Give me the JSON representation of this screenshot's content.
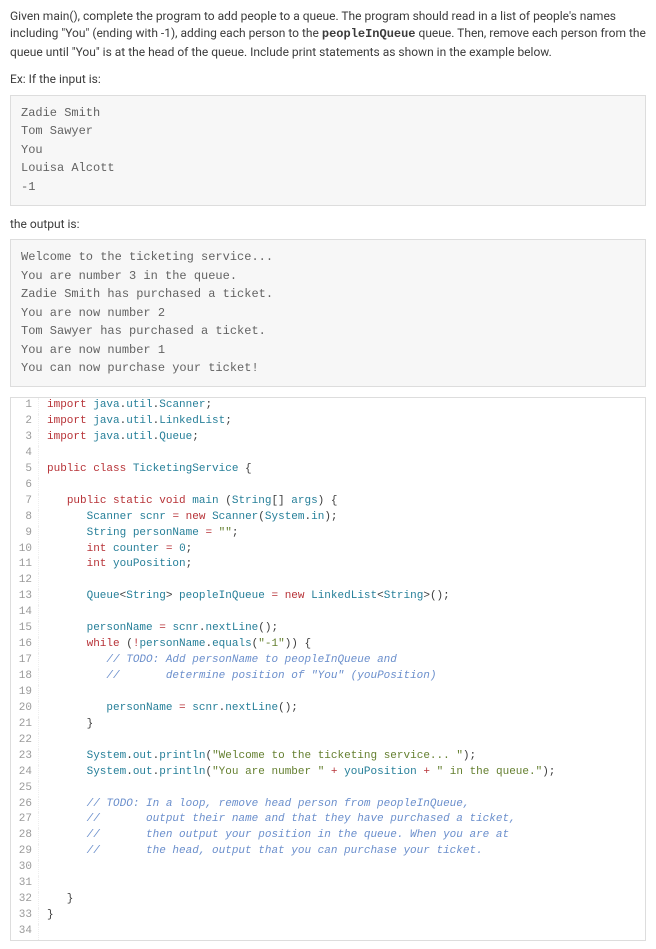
{
  "intro": {
    "part1": "Given main(), complete the program to add people to a queue. The program should read in a list of people's names including \"You\" (ending with -1), adding each person to the ",
    "bold": "peopleInQueue",
    "part2": " queue. Then, remove each person from the queue until \"You\" is at the head of the queue. Include print statements as shown in the example below."
  },
  "ex_header": "Ex: If the input is:",
  "input_block": "Zadie Smith\nTom Sawyer\nYou\nLouisa Alcott\n-1",
  "output_header": "the output is:",
  "output_block": "Welcome to the ticketing service... \nYou are number 3 in the queue.\nZadie Smith has purchased a ticket.\nYou are now number 2\nTom Sawyer has purchased a ticket.\nYou are now number 1\nYou can now purchase your ticket!",
  "code_lines": [
    {
      "n": 1,
      "tokens": [
        [
          "kw",
          "import "
        ],
        [
          "var",
          "java"
        ],
        [
          "plain",
          "."
        ],
        [
          "var",
          "util"
        ],
        [
          "plain",
          "."
        ],
        [
          "var",
          "Scanner"
        ],
        [
          "plain",
          ";"
        ]
      ]
    },
    {
      "n": 2,
      "tokens": [
        [
          "kw",
          "import "
        ],
        [
          "var",
          "java"
        ],
        [
          "plain",
          "."
        ],
        [
          "var",
          "util"
        ],
        [
          "plain",
          "."
        ],
        [
          "var",
          "LinkedList"
        ],
        [
          "plain",
          ";"
        ]
      ]
    },
    {
      "n": 3,
      "tokens": [
        [
          "kw",
          "import "
        ],
        [
          "var",
          "java"
        ],
        [
          "plain",
          "."
        ],
        [
          "var",
          "util"
        ],
        [
          "plain",
          "."
        ],
        [
          "var",
          "Queue"
        ],
        [
          "plain",
          ";"
        ]
      ]
    },
    {
      "n": 4,
      "tokens": []
    },
    {
      "n": 5,
      "tokens": [
        [
          "kw",
          "public class "
        ],
        [
          "var",
          "TicketingService"
        ],
        [
          "plain",
          " {"
        ]
      ]
    },
    {
      "n": 6,
      "tokens": []
    },
    {
      "n": 7,
      "tokens": [
        [
          "plain",
          "   "
        ],
        [
          "kw",
          "public static void "
        ],
        [
          "var",
          "main"
        ],
        [
          "plain",
          " ("
        ],
        [
          "var",
          "String"
        ],
        [
          "plain",
          "[] "
        ],
        [
          "var",
          "args"
        ],
        [
          "plain",
          ") {"
        ]
      ]
    },
    {
      "n": 8,
      "tokens": [
        [
          "plain",
          "      "
        ],
        [
          "var",
          "Scanner"
        ],
        [
          "plain",
          " "
        ],
        [
          "var",
          "scnr"
        ],
        [
          "plain",
          " "
        ],
        [
          "op",
          "="
        ],
        [
          "plain",
          " "
        ],
        [
          "kw",
          "new "
        ],
        [
          "var",
          "Scanner"
        ],
        [
          "plain",
          "("
        ],
        [
          "var",
          "System"
        ],
        [
          "plain",
          "."
        ],
        [
          "var",
          "in"
        ],
        [
          "plain",
          ");"
        ]
      ]
    },
    {
      "n": 9,
      "tokens": [
        [
          "plain",
          "      "
        ],
        [
          "var",
          "String"
        ],
        [
          "plain",
          " "
        ],
        [
          "var",
          "personName"
        ],
        [
          "plain",
          " "
        ],
        [
          "op",
          "="
        ],
        [
          "plain",
          " "
        ],
        [
          "str",
          "\"\""
        ],
        [
          "plain",
          ";"
        ]
      ]
    },
    {
      "n": 10,
      "tokens": [
        [
          "plain",
          "      "
        ],
        [
          "kw",
          "int "
        ],
        [
          "var",
          "counter"
        ],
        [
          "plain",
          " "
        ],
        [
          "op",
          "="
        ],
        [
          "plain",
          " "
        ],
        [
          "int",
          "0"
        ],
        [
          "plain",
          ";"
        ]
      ]
    },
    {
      "n": 11,
      "tokens": [
        [
          "plain",
          "      "
        ],
        [
          "kw",
          "int "
        ],
        [
          "var",
          "youPosition"
        ],
        [
          "plain",
          ";"
        ]
      ]
    },
    {
      "n": 12,
      "tokens": []
    },
    {
      "n": 13,
      "tokens": [
        [
          "plain",
          "      "
        ],
        [
          "var",
          "Queue"
        ],
        [
          "plain",
          "<"
        ],
        [
          "var",
          "String"
        ],
        [
          "plain",
          "> "
        ],
        [
          "var",
          "peopleInQueue"
        ],
        [
          "plain",
          " "
        ],
        [
          "op",
          "="
        ],
        [
          "plain",
          " "
        ],
        [
          "kw",
          "new "
        ],
        [
          "var",
          "LinkedList"
        ],
        [
          "plain",
          "<"
        ],
        [
          "var",
          "String"
        ],
        [
          "plain",
          ">();"
        ]
      ]
    },
    {
      "n": 14,
      "tokens": []
    },
    {
      "n": 15,
      "tokens": [
        [
          "plain",
          "      "
        ],
        [
          "var",
          "personName"
        ],
        [
          "plain",
          " "
        ],
        [
          "op",
          "="
        ],
        [
          "plain",
          " "
        ],
        [
          "var",
          "scnr"
        ],
        [
          "plain",
          "."
        ],
        [
          "var",
          "nextLine"
        ],
        [
          "plain",
          "();"
        ]
      ]
    },
    {
      "n": 16,
      "tokens": [
        [
          "plain",
          "      "
        ],
        [
          "kw",
          "while"
        ],
        [
          "plain",
          " ("
        ],
        [
          "op",
          "!"
        ],
        [
          "var",
          "personName"
        ],
        [
          "plain",
          "."
        ],
        [
          "var",
          "equals"
        ],
        [
          "plain",
          "("
        ],
        [
          "str",
          "\"-1\""
        ],
        [
          "plain",
          ")) {"
        ]
      ]
    },
    {
      "n": 17,
      "tokens": [
        [
          "plain",
          "         "
        ],
        [
          "cmt",
          "// TODO: Add personName to peopleInQueue and"
        ]
      ]
    },
    {
      "n": 18,
      "tokens": [
        [
          "plain",
          "         "
        ],
        [
          "cmt",
          "//       determine position of \"You\" (youPosition)"
        ]
      ]
    },
    {
      "n": 19,
      "tokens": []
    },
    {
      "n": 20,
      "tokens": [
        [
          "plain",
          "         "
        ],
        [
          "var",
          "personName"
        ],
        [
          "plain",
          " "
        ],
        [
          "op",
          "="
        ],
        [
          "plain",
          " "
        ],
        [
          "var",
          "scnr"
        ],
        [
          "plain",
          "."
        ],
        [
          "var",
          "nextLine"
        ],
        [
          "plain",
          "();"
        ]
      ]
    },
    {
      "n": 21,
      "tokens": [
        [
          "plain",
          "      }"
        ]
      ]
    },
    {
      "n": 22,
      "tokens": []
    },
    {
      "n": 23,
      "tokens": [
        [
          "plain",
          "      "
        ],
        [
          "var",
          "System"
        ],
        [
          "plain",
          "."
        ],
        [
          "var",
          "out"
        ],
        [
          "plain",
          "."
        ],
        [
          "var",
          "println"
        ],
        [
          "plain",
          "("
        ],
        [
          "str",
          "\"Welcome to the ticketing service... \""
        ],
        [
          "plain",
          ");"
        ]
      ]
    },
    {
      "n": 24,
      "tokens": [
        [
          "plain",
          "      "
        ],
        [
          "var",
          "System"
        ],
        [
          "plain",
          "."
        ],
        [
          "var",
          "out"
        ],
        [
          "plain",
          "."
        ],
        [
          "var",
          "println"
        ],
        [
          "plain",
          "("
        ],
        [
          "str",
          "\"You are number \""
        ],
        [
          "plain",
          " "
        ],
        [
          "op",
          "+"
        ],
        [
          "plain",
          " "
        ],
        [
          "var",
          "youPosition"
        ],
        [
          "plain",
          " "
        ],
        [
          "op",
          "+"
        ],
        [
          "plain",
          " "
        ],
        [
          "str",
          "\" in the queue.\""
        ],
        [
          "plain",
          ");"
        ]
      ]
    },
    {
      "n": 25,
      "tokens": []
    },
    {
      "n": 26,
      "tokens": [
        [
          "plain",
          "      "
        ],
        [
          "cmt",
          "// TODO: In a loop, remove head person from peopleInQueue,"
        ]
      ]
    },
    {
      "n": 27,
      "tokens": [
        [
          "plain",
          "      "
        ],
        [
          "cmt",
          "//       output their name and that they have purchased a ticket,"
        ]
      ]
    },
    {
      "n": 28,
      "tokens": [
        [
          "plain",
          "      "
        ],
        [
          "cmt",
          "//       then output your position in the queue. When you are at"
        ]
      ]
    },
    {
      "n": 29,
      "tokens": [
        [
          "plain",
          "      "
        ],
        [
          "cmt",
          "//       the head, output that you can purchase your ticket."
        ]
      ]
    },
    {
      "n": 30,
      "tokens": []
    },
    {
      "n": 31,
      "tokens": []
    },
    {
      "n": 32,
      "tokens": [
        [
          "plain",
          "   }"
        ]
      ]
    },
    {
      "n": 33,
      "tokens": [
        [
          "plain",
          "}"
        ]
      ]
    },
    {
      "n": 34,
      "tokens": []
    }
  ]
}
